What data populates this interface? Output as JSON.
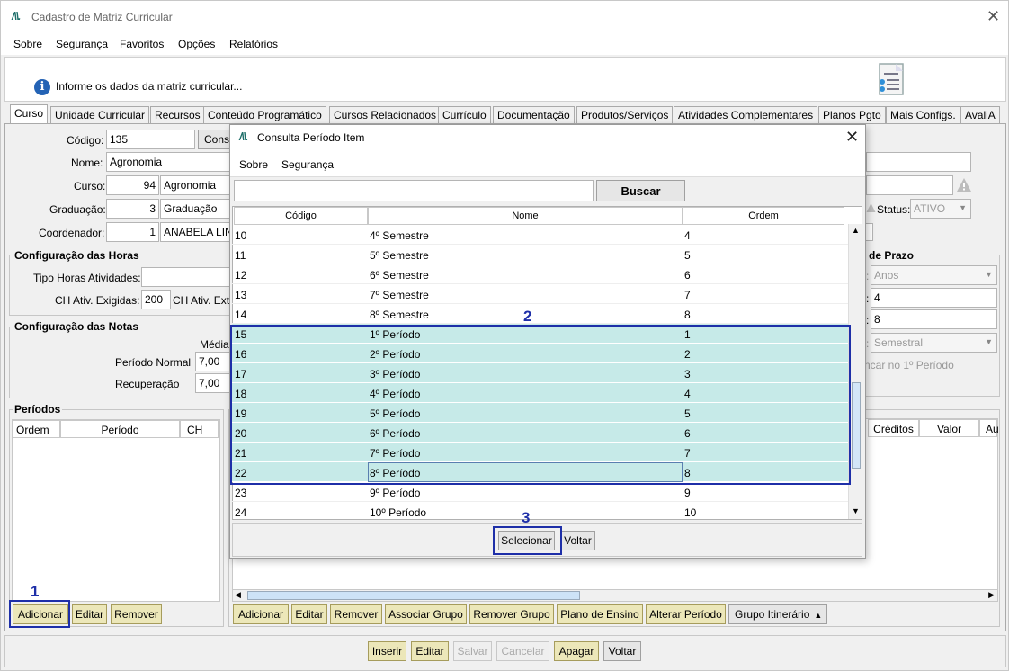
{
  "window": {
    "title": "Cadastro de Matriz Curricular",
    "logo": "/\\\\."
  },
  "menu": [
    "Sobre",
    "Segurança",
    "Favoritos",
    "Opções",
    "Relatórios"
  ],
  "info": {
    "text": "Informe os dados da matriz curricular..."
  },
  "tabs": [
    "Curso",
    "Unidade Curricular",
    "Recursos",
    "Conteúdo Programático",
    "Cursos Relacionados",
    "Currículo",
    "Documentação",
    "Produtos/Serviços",
    "Atividades Complementares",
    "Planos Pgto",
    "Mais Configs.",
    "AvaliA"
  ],
  "form": {
    "codigo_label": "Código:",
    "codigo": "135",
    "consulta_btn": "Consu",
    "nome_label": "Nome:",
    "nome": "Agronomia",
    "curso_label": "Curso:",
    "curso_id": "94",
    "curso_nome": "Agronomia",
    "graduacao_label": "Graduação:",
    "graduacao_id": "3",
    "graduacao_nome": "Graduação",
    "coordenador_label": "Coordenador:",
    "coordenador_id": "1",
    "coordenador_nome": "ANABELA LINS",
    "status_label": "Status:",
    "status": "ATIVO"
  },
  "horas": {
    "title": "Configuração das Horas",
    "tipo_label": "Tipo Horas Atividades:",
    "ch_label": "CH Ativ. Exigidas:",
    "ch_value": "200",
    "ch_ext_label": "CH Ativ. Ext"
  },
  "notas": {
    "title": "Configuração das Notas",
    "media_label": "Média",
    "normal_label": "Período Normal",
    "normal_value": "7,00",
    "recup_label": "Recuperação",
    "recup_value": "7,00"
  },
  "prazo": {
    "title": "de Prazo",
    "unidade": "Anos",
    "min": "4",
    "max": "8",
    "tipo": "Semestral",
    "check_label": "ncar no 1º Período"
  },
  "periodos": {
    "title": "Períodos",
    "cols": [
      "Ordem",
      "Período",
      "CH"
    ],
    "buttons": [
      "Adicionar",
      "Editar",
      "Remover"
    ]
  },
  "grid2": {
    "cols": [
      "Créditos",
      "Valor",
      "Au"
    ],
    "buttons": [
      "Adicionar",
      "Editar",
      "Remover",
      "Associar Grupo",
      "Remover Grupo",
      "Plano de Ensino",
      "Alterar Período",
      "Grupo Itinerário"
    ]
  },
  "footer": {
    "buttons": [
      "Inserir",
      "Editar",
      "Salvar",
      "Cancelar",
      "Apagar",
      "Voltar"
    ]
  },
  "dialog": {
    "title": "Consulta Período Item",
    "menu": [
      "Sobre",
      "Segurança"
    ],
    "search_value": "",
    "search_btn": "Buscar",
    "cols": [
      "Código",
      "Nome",
      "Ordem"
    ],
    "rows": [
      {
        "codigo": "10",
        "nome": "4º Semestre",
        "ordem": "4"
      },
      {
        "codigo": "11",
        "nome": "5º Semestre",
        "ordem": "5"
      },
      {
        "codigo": "12",
        "nome": "6º Semestre",
        "ordem": "6"
      },
      {
        "codigo": "13",
        "nome": "7º Semestre",
        "ordem": "7"
      },
      {
        "codigo": "14",
        "nome": "8º Semestre",
        "ordem": "8"
      },
      {
        "codigo": "15",
        "nome": "1º Período",
        "ordem": "1"
      },
      {
        "codigo": "16",
        "nome": "2º Período",
        "ordem": "2"
      },
      {
        "codigo": "17",
        "nome": "3º Período",
        "ordem": "3"
      },
      {
        "codigo": "18",
        "nome": "4º Período",
        "ordem": "4"
      },
      {
        "codigo": "19",
        "nome": "5º Período",
        "ordem": "5"
      },
      {
        "codigo": "20",
        "nome": "6º Período",
        "ordem": "6"
      },
      {
        "codigo": "21",
        "nome": "7º Período",
        "ordem": "7"
      },
      {
        "codigo": "22",
        "nome": "8º Período",
        "ordem": "8"
      },
      {
        "codigo": "23",
        "nome": "9º Período",
        "ordem": "9"
      },
      {
        "codigo": "24",
        "nome": "10º Período",
        "ordem": "10"
      }
    ],
    "selecionar_btn": "Selecionar",
    "voltar_btn": "Voltar"
  },
  "annotations": [
    "1",
    "2",
    "3"
  ],
  "colors": {
    "selected_row": "#c6eae8",
    "highlight_box": "#1e2fa8",
    "button_bg": "#ece7b9"
  }
}
